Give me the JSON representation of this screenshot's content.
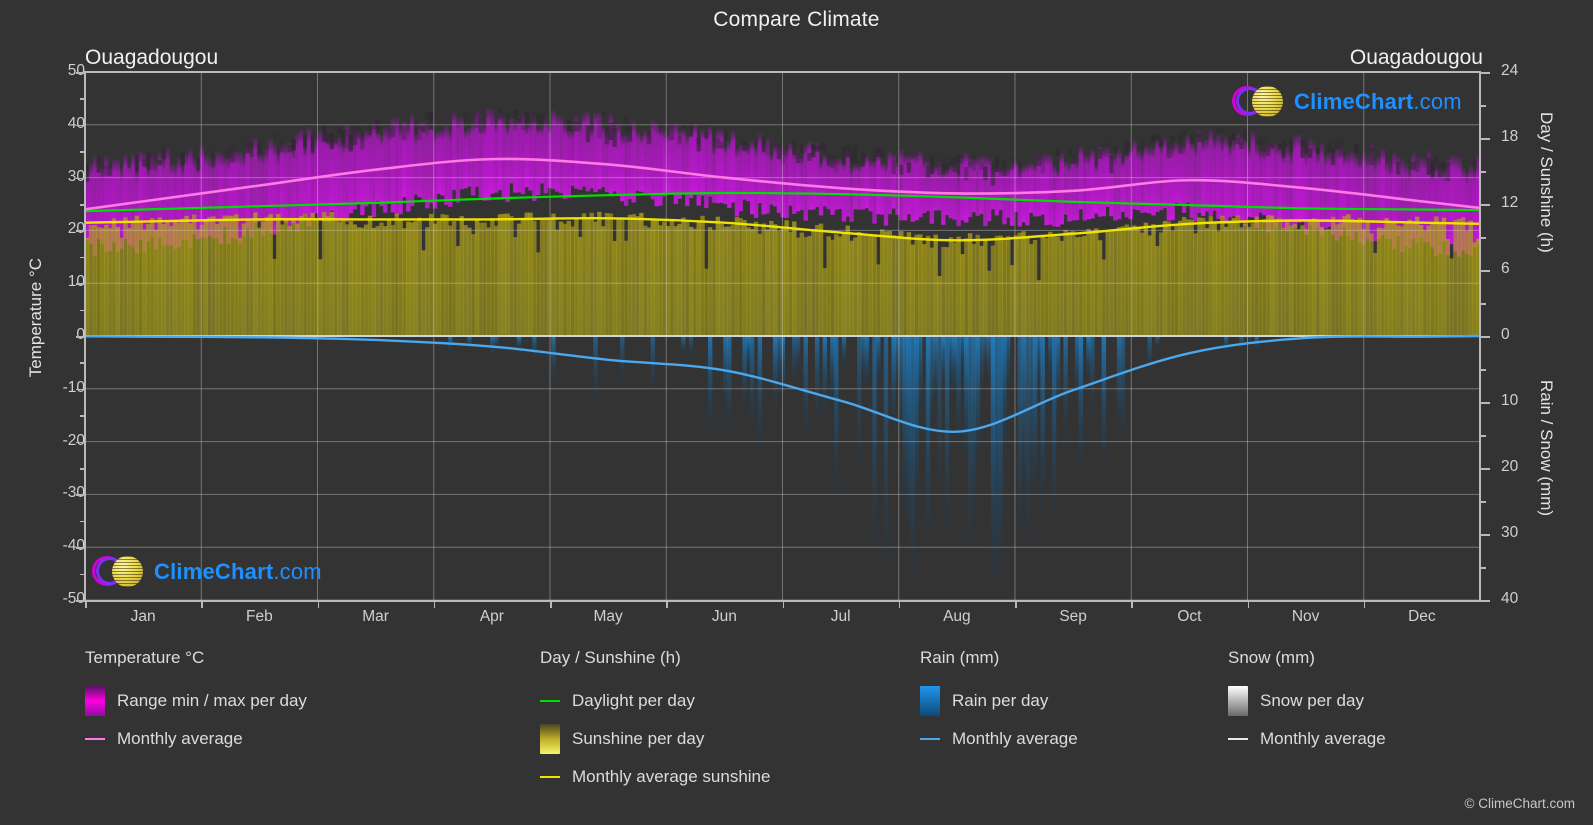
{
  "header": {
    "title": "Compare Climate",
    "location_left": "Ouagadougou",
    "location_right": "Ouagadougou"
  },
  "watermark": {
    "brand": "ClimeChart",
    "suffix": ".com",
    "copyright": "© ClimeChart.com"
  },
  "axes": {
    "left_title": "Temperature °C",
    "right_title_top": "Day / Sunshine (h)",
    "right_title_bottom": "Rain / Snow (mm)",
    "left_ticks": [
      "50",
      "40",
      "30",
      "20",
      "10",
      "0",
      "-10",
      "-20",
      "-30",
      "-40",
      "-50"
    ],
    "right_ticks_top": [
      "24",
      "18",
      "12",
      "6",
      "0"
    ],
    "right_ticks_bottom": [
      "10",
      "20",
      "30",
      "40"
    ],
    "x_ticks": [
      "Jan",
      "Feb",
      "Mar",
      "Apr",
      "May",
      "Jun",
      "Jul",
      "Aug",
      "Sep",
      "Oct",
      "Nov",
      "Dec"
    ]
  },
  "legend": {
    "groups": [
      {
        "title": "Temperature °C",
        "items": [
          {
            "label": "Range min / max per day",
            "type": "swatch",
            "color": "#ff00e0"
          },
          {
            "label": "Monthly average",
            "type": "line",
            "color": "#ff7ae6"
          }
        ]
      },
      {
        "title": "Day / Sunshine (h)",
        "items": [
          {
            "label": "Daylight per day",
            "type": "line",
            "color": "#00e000"
          },
          {
            "label": "Sunshine per day",
            "type": "swatch",
            "color": "#f3f04a"
          },
          {
            "label": "Monthly average sunshine",
            "type": "line",
            "color": "#efe400"
          }
        ]
      },
      {
        "title": "Rain (mm)",
        "items": [
          {
            "label": "Rain per day",
            "type": "swatch",
            "color": "#1c8ee0"
          },
          {
            "label": "Monthly average",
            "type": "line",
            "color": "#4aa8ef"
          }
        ]
      },
      {
        "title": "Snow (mm)",
        "items": [
          {
            "label": "Snow per day",
            "type": "swatch",
            "color": "#e8e8e8"
          },
          {
            "label": "Monthly average",
            "type": "line",
            "color": "#e8e8e8"
          }
        ]
      }
    ]
  },
  "chart_data": {
    "type": "area",
    "title": "Compare Climate",
    "subtitle": "Ouagadougou",
    "xlabel": "",
    "ylabel": "Temperature °C",
    "y2label_top": "Day / Sunshine (h)",
    "y2label_bottom": "Rain / Snow (mm)",
    "ylim": [
      -50,
      50
    ],
    "y2lim_top": [
      0,
      24
    ],
    "y2lim_bottom": [
      0,
      40
    ],
    "grid": true,
    "legend_position": "below",
    "categories": [
      "Jan",
      "Feb",
      "Mar",
      "Apr",
      "May",
      "Jun",
      "Jul",
      "Aug",
      "Sep",
      "Oct",
      "Nov",
      "Dec"
    ],
    "series": [
      {
        "name": "Monthly average temperature",
        "unit": "°C",
        "color": "#ff7ae6",
        "axis": "left",
        "values": [
          25.5,
          28.5,
          31.5,
          33.5,
          32.5,
          30.0,
          28.0,
          27.0,
          27.5,
          29.5,
          28.0,
          25.5
        ]
      },
      {
        "name": "Daily max temperature",
        "unit": "°C",
        "color": "#ff00e0",
        "axis": "left",
        "values": [
          33.0,
          36.0,
          39.0,
          41.0,
          40.0,
          37.0,
          34.0,
          32.5,
          33.5,
          37.0,
          36.0,
          33.0
        ]
      },
      {
        "name": "Daily min temperature",
        "unit": "°C",
        "color": "#ff00e0",
        "axis": "left",
        "values": [
          17.0,
          20.0,
          24.0,
          27.0,
          26.5,
          24.5,
          23.0,
          22.5,
          22.5,
          23.5,
          20.0,
          17.0
        ]
      },
      {
        "name": "Daylight per day",
        "unit": "h",
        "color": "#00e000",
        "axis": "right_top",
        "values": [
          11.5,
          11.8,
          12.1,
          12.5,
          12.8,
          13.0,
          12.9,
          12.6,
          12.2,
          11.9,
          11.6,
          11.5
        ]
      },
      {
        "name": "Monthly average sunshine",
        "unit": "h",
        "color": "#efe400",
        "axis": "right_top",
        "values": [
          10.4,
          10.6,
          10.6,
          10.6,
          10.7,
          10.3,
          9.4,
          8.7,
          9.3,
          10.2,
          10.5,
          10.3
        ]
      },
      {
        "name": "Monthly average rain",
        "unit": "mm",
        "color": "#4aa8ef",
        "axis": "right_bottom",
        "values": [
          0.1,
          0.2,
          0.6,
          1.6,
          3.6,
          5.2,
          9.8,
          14.5,
          8.2,
          2.6,
          0.3,
          0.1
        ]
      },
      {
        "name": "Monthly average snow",
        "unit": "mm",
        "color": "#e8e8e8",
        "axis": "right_bottom",
        "values": [
          0,
          0,
          0,
          0,
          0,
          0,
          0,
          0,
          0,
          0,
          0,
          0
        ]
      }
    ]
  }
}
